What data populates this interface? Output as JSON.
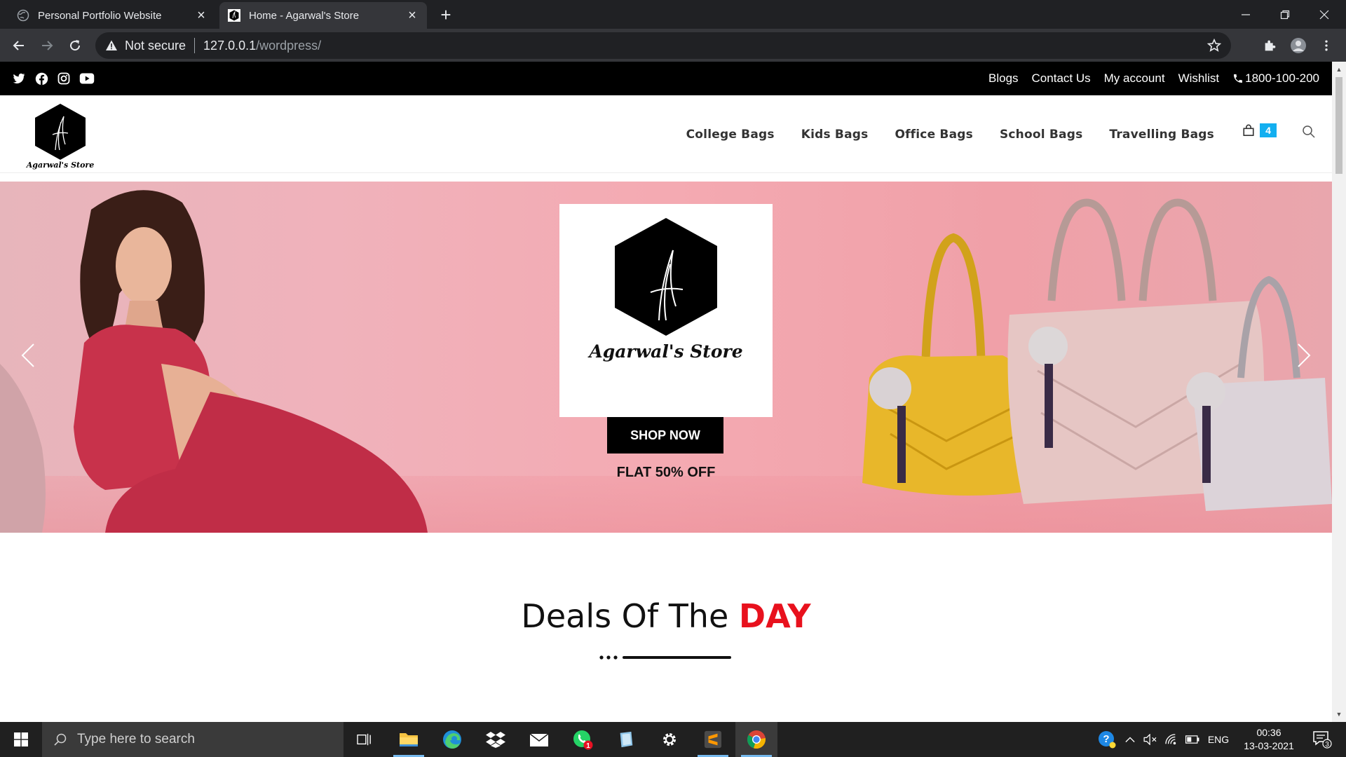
{
  "browser": {
    "tabs": [
      {
        "title": "Personal Portfolio Website",
        "active": false
      },
      {
        "title": "Home - Agarwal's Store",
        "active": true
      }
    ],
    "security_label": "Not secure",
    "url_host": "127.0.0.1",
    "url_path": "/wordpress/"
  },
  "site": {
    "topbar": {
      "links": [
        "Blogs",
        "Contact Us",
        "My account",
        "Wishlist"
      ],
      "phone": "1800-100-200"
    },
    "brand": "Agarwal's Store",
    "nav": [
      "College Bags",
      "Kids Bags",
      "Office Bags",
      "School Bags",
      "Travelling Bags"
    ],
    "cart_count": "4",
    "hero": {
      "cta": "SHOP NOW",
      "offer": "FLAT 50% OFF"
    },
    "deals": {
      "prefix": "Deals Of The ",
      "highlight": "DAY"
    }
  },
  "colors": {
    "accent_red": "#e8111d",
    "badge_blue": "#13aff0",
    "topbar_bg": "#000000"
  },
  "taskbar": {
    "search_placeholder": "Type here to search",
    "language": "ENG",
    "time": "00:36",
    "date": "13-03-2021",
    "whatsapp_badge": "1",
    "notification_count": "3"
  }
}
